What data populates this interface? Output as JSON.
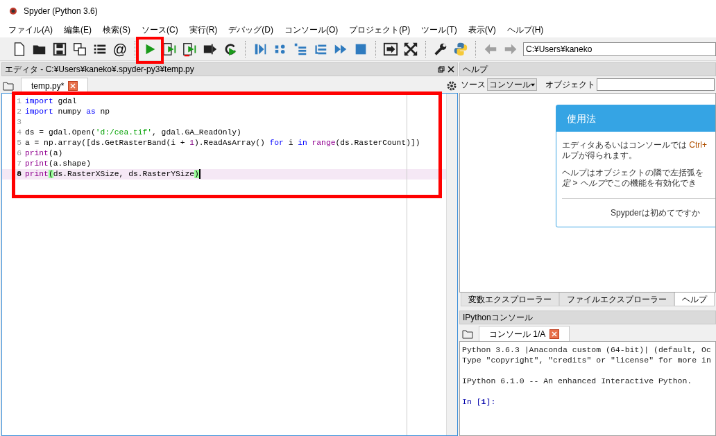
{
  "window": {
    "title": "Spyder (Python 3.6)"
  },
  "menu": [
    "ファイル(A)",
    "編集(E)",
    "検索(S)",
    "ソース(C)",
    "実行(R)",
    "デバッグ(D)",
    "コンソール(O)",
    "プロジェクト(P)",
    "ツール(T)",
    "表示(V)",
    "ヘルプ(H)"
  ],
  "toolbar": [
    {
      "kind": "new",
      "highlighted": false
    },
    {
      "kind": "open",
      "highlighted": false
    },
    {
      "kind": "save",
      "highlighted": false
    },
    {
      "kind": "save-all",
      "highlighted": false
    },
    {
      "kind": "outline",
      "highlighted": false
    },
    {
      "kind": "text",
      "label": "@",
      "highlighted": false
    },
    {
      "kind": "sep"
    },
    {
      "kind": "run",
      "highlighted": true
    },
    {
      "kind": "run-cell",
      "highlighted": false
    },
    {
      "kind": "run-cell-advance",
      "highlighted": false
    },
    {
      "kind": "run-selection",
      "highlighted": false
    },
    {
      "kind": "rerun",
      "highlighted": false
    },
    {
      "kind": "sep"
    },
    {
      "kind": "debug",
      "highlighted": false
    },
    {
      "kind": "step",
      "highlighted": false
    },
    {
      "kind": "step-into",
      "highlighted": false
    },
    {
      "kind": "step-return",
      "highlighted": false
    },
    {
      "kind": "continue",
      "highlighted": false
    },
    {
      "kind": "stop",
      "highlighted": false
    },
    {
      "kind": "sep"
    },
    {
      "kind": "maximize",
      "highlighted": false
    },
    {
      "kind": "fullscreen",
      "highlighted": false
    },
    {
      "kind": "sep"
    },
    {
      "kind": "preferences",
      "highlighted": false
    },
    {
      "kind": "python-path",
      "highlighted": false
    },
    {
      "kind": "sep"
    },
    {
      "kind": "back",
      "highlighted": false
    },
    {
      "kind": "forward",
      "highlighted": false
    }
  ],
  "path_field": {
    "value": "C:¥Users¥kaneko"
  },
  "editor": {
    "title": "エディタ - C:¥Users¥kaneko¥.spyder-py3¥temp.py",
    "highlighted": true,
    "tabs": [
      {
        "label": "temp.py*",
        "selected": true
      }
    ],
    "lines": [
      {
        "number": "1",
        "current": false,
        "tokens": [
          {
            "kind": "keyword",
            "text": "import"
          },
          {
            "kind": "plain",
            "text": " gdal"
          }
        ]
      },
      {
        "number": "2",
        "current": false,
        "tokens": [
          {
            "kind": "keyword",
            "text": "import"
          },
          {
            "kind": "plain",
            "text": " numpy "
          },
          {
            "kind": "keyword",
            "text": "as"
          },
          {
            "kind": "plain",
            "text": " np"
          }
        ]
      },
      {
        "number": "3",
        "current": false
      },
      {
        "number": "4",
        "current": false,
        "tokens": [
          {
            "kind": "plain",
            "text": "ds = gdal.Open("
          },
          {
            "kind": "string",
            "text": "'d:/cea.tif'"
          },
          {
            "kind": "plain",
            "text": ", gdal.GA_ReadOnly)"
          }
        ]
      },
      {
        "number": "5",
        "current": false,
        "tokens": [
          {
            "kind": "plain",
            "text": "a = np.array([ds.GetRasterBand(i + "
          },
          {
            "kind": "number",
            "text": "1"
          },
          {
            "kind": "plain",
            "text": ").ReadAsArray() "
          },
          {
            "kind": "keyword",
            "text": "for"
          },
          {
            "kind": "plain",
            "text": " i "
          },
          {
            "kind": "keyword",
            "text": "in "
          },
          {
            "kind": "builtin",
            "text": "range"
          },
          {
            "kind": "plain",
            "text": "(ds.RasterCount)])"
          }
        ]
      },
      {
        "number": "6",
        "current": false,
        "tokens": [
          {
            "kind": "builtin",
            "text": "print"
          },
          {
            "kind": "plain",
            "text": "(a)"
          }
        ]
      },
      {
        "number": "7",
        "current": false,
        "tokens": [
          {
            "kind": "builtin",
            "text": "print"
          },
          {
            "kind": "plain",
            "text": "(a.shape)"
          }
        ]
      },
      {
        "number": "8",
        "current": true,
        "tokens": [
          {
            "kind": "builtin",
            "text": "print"
          },
          {
            "kind": "match",
            "text": "("
          },
          {
            "kind": "plain",
            "text": "ds.RasterXSize, ds.RasterYSize"
          },
          {
            "kind": "match",
            "text": ")"
          }
        ]
      }
    ]
  },
  "help": {
    "title": "ヘルプ",
    "source_label": "ソース",
    "source_value": "コンソール",
    "object_label": "オブジェクト",
    "card": {
      "heading": "使用法",
      "paragraphs": [
        [
          [
            {
              "kind": "plain",
              "text": "エディタあるいはコンソールでは "
            },
            {
              "kind": "key",
              "text": "Ctrl+"
            }
          ],
          [
            {
              "kind": "plain",
              "text": "ルプが得られます。"
            }
          ]
        ],
        [
          [
            {
              "kind": "plain",
              "text": "ヘルプはオブジェクトの隣で左括弧を"
            }
          ],
          [
            {
              "kind": "italic",
              "text": "定 > ヘルプ"
            },
            {
              "kind": "plain",
              "text": "でこの機能を有効化でき"
            }
          ]
        ]
      ],
      "footer": "Spypderは初めてですか"
    }
  },
  "bottom_tabs": [
    {
      "label": "変数エクスプローラー",
      "selected": false
    },
    {
      "label": "ファイルエクスプローラー",
      "selected": false
    },
    {
      "label": "ヘルプ",
      "selected": true
    }
  ],
  "console": {
    "title": "IPythonコンソール",
    "tabs": [
      {
        "label": "コンソール 1/A",
        "selected": true
      }
    ],
    "lines": [
      {
        "kind": "output",
        "text": "Python 3.6.3 |Anaconda custom (64-bit)| (default, Oc"
      },
      {
        "kind": "output",
        "text": "Type \"copyright\", \"credits\" or \"license\" for more in"
      },
      {
        "kind": "blank"
      },
      {
        "kind": "output",
        "text": "IPython 6.1.0 -- An enhanced Interactive Python."
      },
      {
        "kind": "blank"
      },
      {
        "kind": "prompt",
        "text": "In [**1**]:"
      }
    ]
  }
}
